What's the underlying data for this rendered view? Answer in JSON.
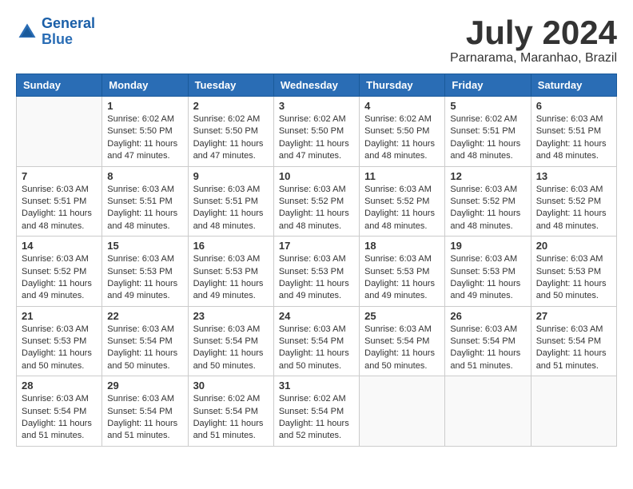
{
  "logo": {
    "text1": "General",
    "text2": "Blue"
  },
  "title": "July 2024",
  "location": "Parnarama, Maranhao, Brazil",
  "days_of_week": [
    "Sunday",
    "Monday",
    "Tuesday",
    "Wednesday",
    "Thursday",
    "Friday",
    "Saturday"
  ],
  "weeks": [
    [
      {
        "day": "",
        "sunrise": "",
        "sunset": "",
        "daylight": ""
      },
      {
        "day": "1",
        "sunrise": "Sunrise: 6:02 AM",
        "sunset": "Sunset: 5:50 PM",
        "daylight": "Daylight: 11 hours and 47 minutes."
      },
      {
        "day": "2",
        "sunrise": "Sunrise: 6:02 AM",
        "sunset": "Sunset: 5:50 PM",
        "daylight": "Daylight: 11 hours and 47 minutes."
      },
      {
        "day": "3",
        "sunrise": "Sunrise: 6:02 AM",
        "sunset": "Sunset: 5:50 PM",
        "daylight": "Daylight: 11 hours and 47 minutes."
      },
      {
        "day": "4",
        "sunrise": "Sunrise: 6:02 AM",
        "sunset": "Sunset: 5:50 PM",
        "daylight": "Daylight: 11 hours and 48 minutes."
      },
      {
        "day": "5",
        "sunrise": "Sunrise: 6:02 AM",
        "sunset": "Sunset: 5:51 PM",
        "daylight": "Daylight: 11 hours and 48 minutes."
      },
      {
        "day": "6",
        "sunrise": "Sunrise: 6:03 AM",
        "sunset": "Sunset: 5:51 PM",
        "daylight": "Daylight: 11 hours and 48 minutes."
      }
    ],
    [
      {
        "day": "7",
        "sunrise": "Sunrise: 6:03 AM",
        "sunset": "Sunset: 5:51 PM",
        "daylight": "Daylight: 11 hours and 48 minutes."
      },
      {
        "day": "8",
        "sunrise": "Sunrise: 6:03 AM",
        "sunset": "Sunset: 5:51 PM",
        "daylight": "Daylight: 11 hours and 48 minutes."
      },
      {
        "day": "9",
        "sunrise": "Sunrise: 6:03 AM",
        "sunset": "Sunset: 5:51 PM",
        "daylight": "Daylight: 11 hours and 48 minutes."
      },
      {
        "day": "10",
        "sunrise": "Sunrise: 6:03 AM",
        "sunset": "Sunset: 5:52 PM",
        "daylight": "Daylight: 11 hours and 48 minutes."
      },
      {
        "day": "11",
        "sunrise": "Sunrise: 6:03 AM",
        "sunset": "Sunset: 5:52 PM",
        "daylight": "Daylight: 11 hours and 48 minutes."
      },
      {
        "day": "12",
        "sunrise": "Sunrise: 6:03 AM",
        "sunset": "Sunset: 5:52 PM",
        "daylight": "Daylight: 11 hours and 48 minutes."
      },
      {
        "day": "13",
        "sunrise": "Sunrise: 6:03 AM",
        "sunset": "Sunset: 5:52 PM",
        "daylight": "Daylight: 11 hours and 48 minutes."
      }
    ],
    [
      {
        "day": "14",
        "sunrise": "Sunrise: 6:03 AM",
        "sunset": "Sunset: 5:52 PM",
        "daylight": "Daylight: 11 hours and 49 minutes."
      },
      {
        "day": "15",
        "sunrise": "Sunrise: 6:03 AM",
        "sunset": "Sunset: 5:53 PM",
        "daylight": "Daylight: 11 hours and 49 minutes."
      },
      {
        "day": "16",
        "sunrise": "Sunrise: 6:03 AM",
        "sunset": "Sunset: 5:53 PM",
        "daylight": "Daylight: 11 hours and 49 minutes."
      },
      {
        "day": "17",
        "sunrise": "Sunrise: 6:03 AM",
        "sunset": "Sunset: 5:53 PM",
        "daylight": "Daylight: 11 hours and 49 minutes."
      },
      {
        "day": "18",
        "sunrise": "Sunrise: 6:03 AM",
        "sunset": "Sunset: 5:53 PM",
        "daylight": "Daylight: 11 hours and 49 minutes."
      },
      {
        "day": "19",
        "sunrise": "Sunrise: 6:03 AM",
        "sunset": "Sunset: 5:53 PM",
        "daylight": "Daylight: 11 hours and 49 minutes."
      },
      {
        "day": "20",
        "sunrise": "Sunrise: 6:03 AM",
        "sunset": "Sunset: 5:53 PM",
        "daylight": "Daylight: 11 hours and 50 minutes."
      }
    ],
    [
      {
        "day": "21",
        "sunrise": "Sunrise: 6:03 AM",
        "sunset": "Sunset: 5:53 PM",
        "daylight": "Daylight: 11 hours and 50 minutes."
      },
      {
        "day": "22",
        "sunrise": "Sunrise: 6:03 AM",
        "sunset": "Sunset: 5:54 PM",
        "daylight": "Daylight: 11 hours and 50 minutes."
      },
      {
        "day": "23",
        "sunrise": "Sunrise: 6:03 AM",
        "sunset": "Sunset: 5:54 PM",
        "daylight": "Daylight: 11 hours and 50 minutes."
      },
      {
        "day": "24",
        "sunrise": "Sunrise: 6:03 AM",
        "sunset": "Sunset: 5:54 PM",
        "daylight": "Daylight: 11 hours and 50 minutes."
      },
      {
        "day": "25",
        "sunrise": "Sunrise: 6:03 AM",
        "sunset": "Sunset: 5:54 PM",
        "daylight": "Daylight: 11 hours and 50 minutes."
      },
      {
        "day": "26",
        "sunrise": "Sunrise: 6:03 AM",
        "sunset": "Sunset: 5:54 PM",
        "daylight": "Daylight: 11 hours and 51 minutes."
      },
      {
        "day": "27",
        "sunrise": "Sunrise: 6:03 AM",
        "sunset": "Sunset: 5:54 PM",
        "daylight": "Daylight: 11 hours and 51 minutes."
      }
    ],
    [
      {
        "day": "28",
        "sunrise": "Sunrise: 6:03 AM",
        "sunset": "Sunset: 5:54 PM",
        "daylight": "Daylight: 11 hours and 51 minutes."
      },
      {
        "day": "29",
        "sunrise": "Sunrise: 6:03 AM",
        "sunset": "Sunset: 5:54 PM",
        "daylight": "Daylight: 11 hours and 51 minutes."
      },
      {
        "day": "30",
        "sunrise": "Sunrise: 6:02 AM",
        "sunset": "Sunset: 5:54 PM",
        "daylight": "Daylight: 11 hours and 51 minutes."
      },
      {
        "day": "31",
        "sunrise": "Sunrise: 6:02 AM",
        "sunset": "Sunset: 5:54 PM",
        "daylight": "Daylight: 11 hours and 52 minutes."
      },
      {
        "day": "",
        "sunrise": "",
        "sunset": "",
        "daylight": ""
      },
      {
        "day": "",
        "sunrise": "",
        "sunset": "",
        "daylight": ""
      },
      {
        "day": "",
        "sunrise": "",
        "sunset": "",
        "daylight": ""
      }
    ]
  ]
}
